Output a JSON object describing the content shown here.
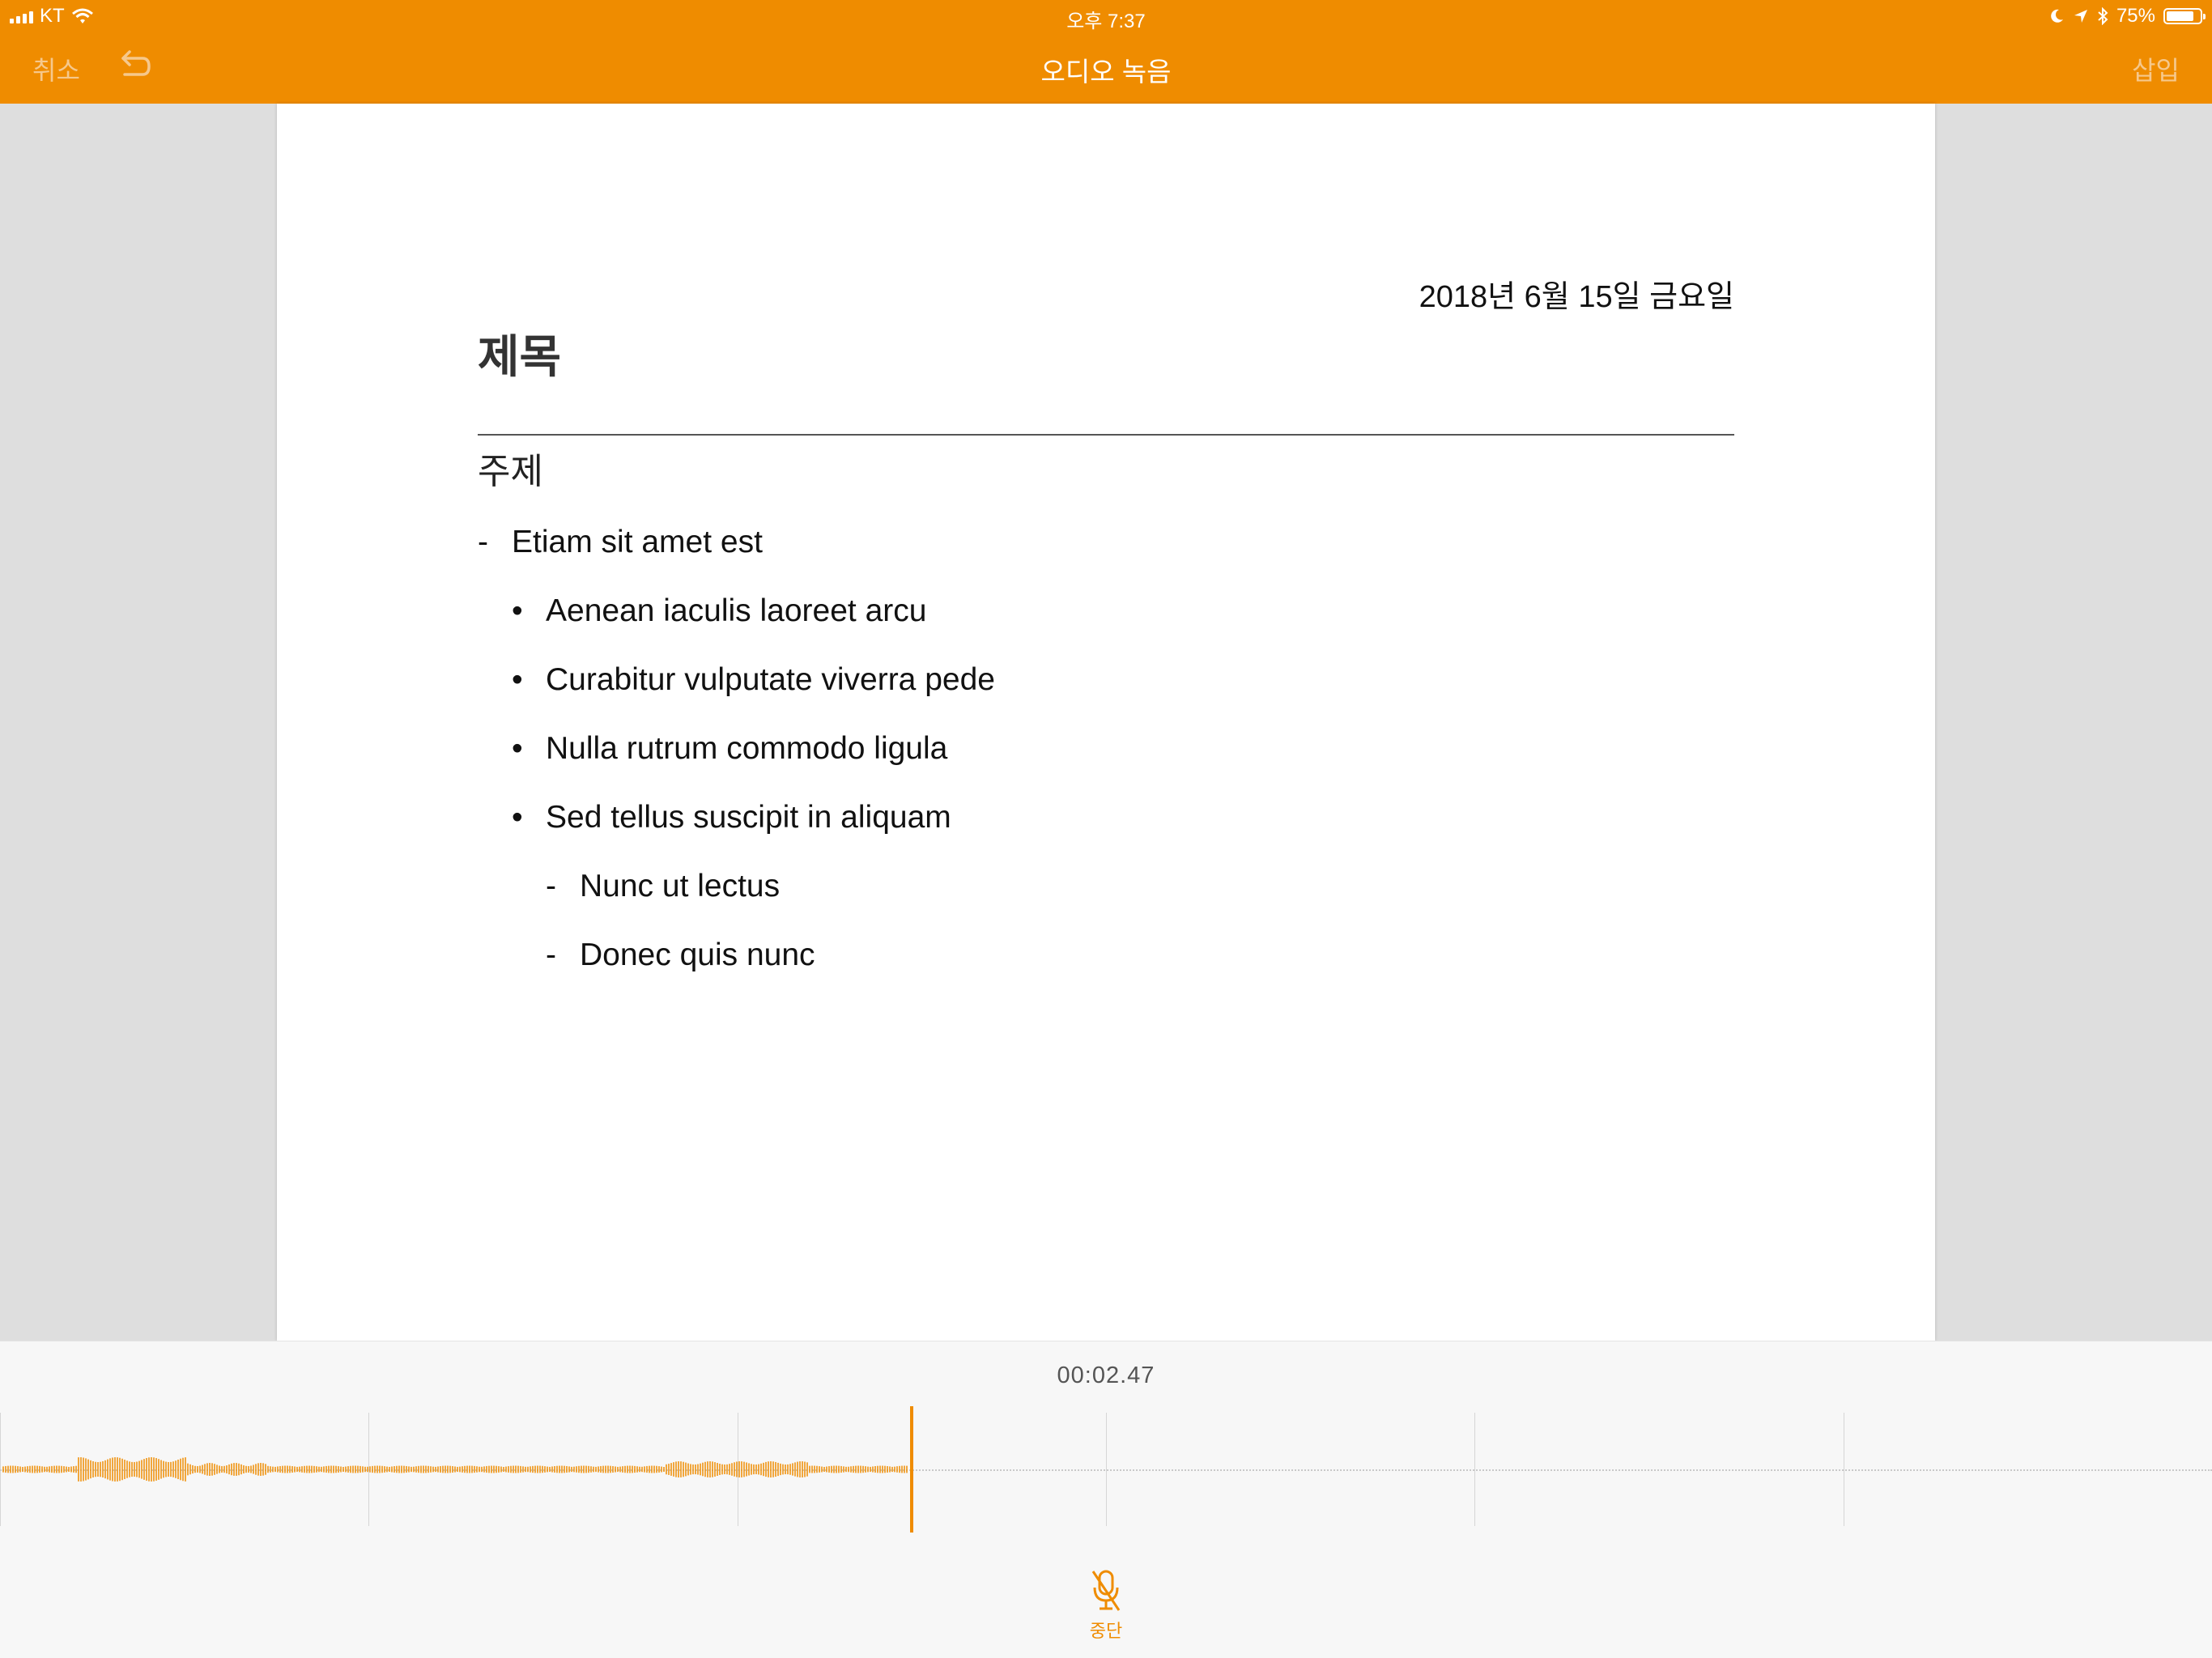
{
  "status_bar": {
    "carrier": "KT",
    "time": "오후 7:37",
    "battery": "75%"
  },
  "nav": {
    "cancel": "취소",
    "title": "오디오 녹음",
    "insert": "삽입"
  },
  "document": {
    "date": "2018년 6월 15일 금요일",
    "title": "제목",
    "subject": "주제",
    "items": [
      {
        "marker": "-",
        "text": "Etiam sit amet est"
      },
      {
        "marker": "•",
        "text": "Aenean iaculis laoreet arcu"
      },
      {
        "marker": "•",
        "text": "Curabitur vulputate viverra pede"
      },
      {
        "marker": "•",
        "text": "Nulla rutrum commodo ligula"
      },
      {
        "marker": "•",
        "text": "Sed tellus suscipit in aliquam"
      },
      {
        "marker": "-",
        "text": "Nunc ut lectus"
      },
      {
        "marker": "-",
        "text": "Donec quis nunc"
      }
    ]
  },
  "recorder": {
    "elapsed": "00:02.47",
    "stop_label": "중단"
  },
  "colors": {
    "accent": "#ef8c00",
    "disabled_nav": "#f6c88c"
  },
  "icons": [
    "signal-icon",
    "wifi-icon",
    "moon-icon",
    "location-icon",
    "bluetooth-icon",
    "battery-icon",
    "undo-icon",
    "mic-off-icon"
  ]
}
